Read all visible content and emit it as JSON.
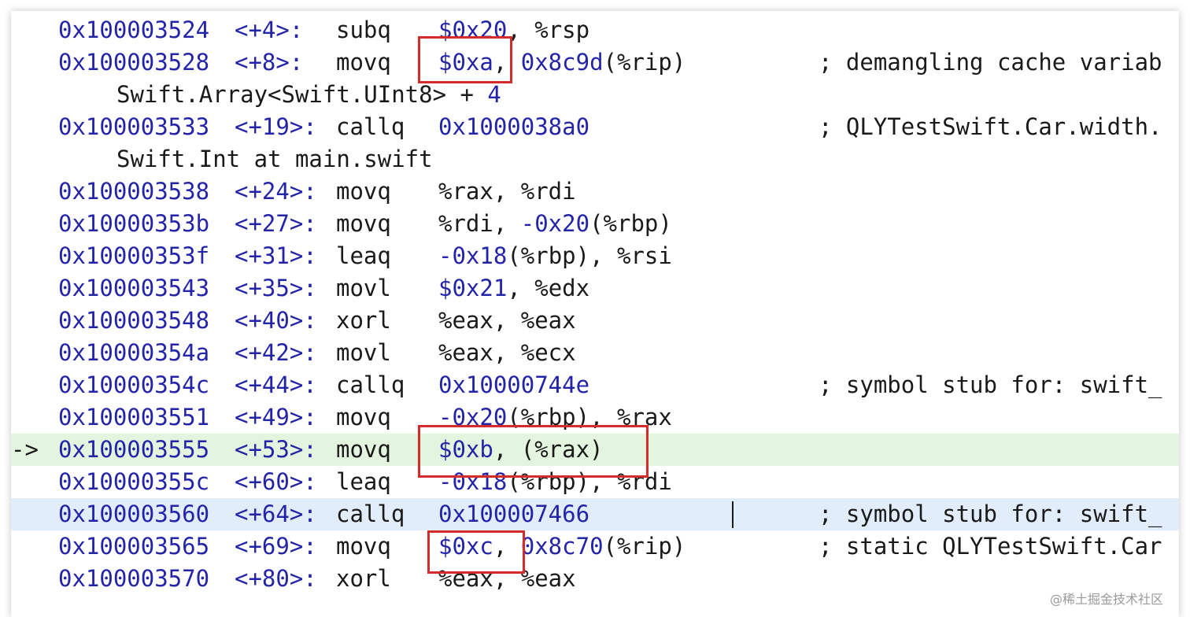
{
  "lines": [
    {
      "addr": "0x100003524",
      "off": "<+4>:",
      "mnem": "subq",
      "ops": [
        {
          "t": "$0x20",
          "c": "n"
        },
        {
          "t": ", %rsp",
          "c": "p"
        }
      ],
      "comment": ""
    },
    {
      "addr": "0x100003528",
      "off": "<+8>:",
      "mnem": "movq",
      "ops": [
        {
          "t": "$0xa",
          "c": "n"
        },
        {
          "t": ", ",
          "c": "p"
        },
        {
          "t": "0x8c9d",
          "c": "n"
        },
        {
          "t": "(%rip)",
          "c": "p"
        }
      ],
      "comment": "; demangling cache variab"
    },
    {
      "cont": "Swift.Array<Swift.UInt8> + ",
      "cont_num": "4"
    },
    {
      "addr": "0x100003533",
      "off": "<+19>:",
      "mnem": "callq",
      "ops": [
        {
          "t": "0x1000038a0",
          "c": "n"
        }
      ],
      "comment": "; QLYTestSwift.Car.width."
    },
    {
      "cont": "Swift.Int at main.swift",
      "cont_num": ""
    },
    {
      "addr": "0x100003538",
      "off": "<+24>:",
      "mnem": "movq",
      "ops": [
        {
          "t": "%rax, %rdi",
          "c": "p"
        }
      ],
      "comment": ""
    },
    {
      "addr": "0x10000353b",
      "off": "<+27>:",
      "mnem": "movq",
      "ops": [
        {
          "t": "%rdi, ",
          "c": "p"
        },
        {
          "t": "-0x20",
          "c": "n"
        },
        {
          "t": "(%rbp)",
          "c": "p"
        }
      ],
      "comment": ""
    },
    {
      "addr": "0x10000353f",
      "off": "<+31>:",
      "mnem": "leaq",
      "ops": [
        {
          "t": "-0x18",
          "c": "n"
        },
        {
          "t": "(%rbp), %rsi",
          "c": "p"
        }
      ],
      "comment": ""
    },
    {
      "addr": "0x100003543",
      "off": "<+35>:",
      "mnem": "movl",
      "ops": [
        {
          "t": "$0x21",
          "c": "n"
        },
        {
          "t": ", %edx",
          "c": "p"
        }
      ],
      "comment": ""
    },
    {
      "addr": "0x100003548",
      "off": "<+40>:",
      "mnem": "xorl",
      "ops": [
        {
          "t": "%eax, %eax",
          "c": "p"
        }
      ],
      "comment": ""
    },
    {
      "addr": "0x10000354a",
      "off": "<+42>:",
      "mnem": "movl",
      "ops": [
        {
          "t": "%eax, %ecx",
          "c": "p"
        }
      ],
      "comment": ""
    },
    {
      "addr": "0x10000354c",
      "off": "<+44>:",
      "mnem": "callq",
      "ops": [
        {
          "t": "0x10000744e",
          "c": "n"
        }
      ],
      "comment": "; symbol stub for: swift_"
    },
    {
      "addr": "0x100003551",
      "off": "<+49>:",
      "mnem": "movq",
      "ops": [
        {
          "t": "-0x20",
          "c": "n"
        },
        {
          "t": "(%rbp), %rax",
          "c": "p"
        }
      ],
      "comment": ""
    },
    {
      "addr": "0x100003555",
      "off": "<+53>:",
      "mnem": "movq",
      "ops": [
        {
          "t": "$0xb",
          "c": "n"
        },
        {
          "t": ", (%rax)",
          "c": "p"
        }
      ],
      "comment": "",
      "current": true,
      "arrow": "->"
    },
    {
      "addr": "0x10000355c",
      "off": "<+60>:",
      "mnem": "leaq",
      "ops": [
        {
          "t": "-0x18",
          "c": "n"
        },
        {
          "t": "(%rbp), %rdi",
          "c": "p"
        }
      ],
      "comment": ""
    },
    {
      "addr": "0x100003560",
      "off": "<+64>:",
      "mnem": "callq",
      "ops": [
        {
          "t": "0x100007466",
          "c": "n"
        }
      ],
      "comment": "; symbol stub for: swift_",
      "selected": true
    },
    {
      "addr": "0x100003565",
      "off": "<+69>:",
      "mnem": "movq",
      "ops": [
        {
          "t": "$0xc",
          "c": "n"
        },
        {
          "t": ", ",
          "c": "p"
        },
        {
          "t": "0x8c70",
          "c": "n"
        },
        {
          "t": "(%rip)",
          "c": "p"
        }
      ],
      "comment": "; static QLYTestSwift.Car"
    },
    {
      "addr": "0x100003570",
      "off": "<+80>:",
      "mnem": "xorl",
      "ops": [
        {
          "t": "%eax, %eax",
          "c": "p"
        }
      ],
      "comment": ""
    }
  ],
  "watermark": "@稀土掘金技术社区",
  "colors": {
    "address": "#2424a8",
    "text": "#1a1a1a",
    "current_line_bg": "#e3f5df",
    "selected_line_bg": "#e2edfb",
    "highlight_box": "#d42b2b"
  }
}
